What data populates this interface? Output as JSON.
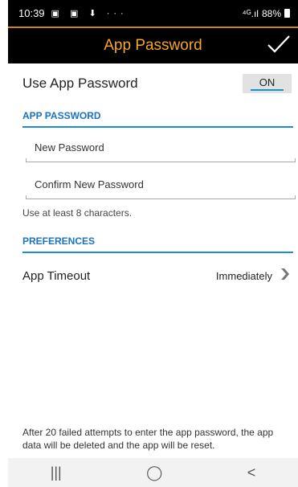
{
  "status_bar": {
    "time": "10:39",
    "icons": "▣ ▣ ⬇ ···",
    "signal": "⁴ᴳ.ıl",
    "battery": "88%"
  },
  "app_bar": {
    "title": "App Password",
    "confirm_icon": "check-icon",
    "title_color": "#f5a623"
  },
  "use_app_password": {
    "label": "Use App Password",
    "toggle_state": "ON"
  },
  "app_password_section": {
    "header": "APP PASSWORD",
    "new_password_placeholder": "New Password",
    "confirm_password_placeholder": "Confirm New Password",
    "hint": "Use at least 8 characters."
  },
  "preferences_section": {
    "header": "PREFERENCES",
    "app_timeout_label": "App Timeout",
    "app_timeout_value": "Immediately"
  },
  "footer": {
    "note": "After 20 failed attempts to enter the app password, the app data will be deleted and the app will be reset."
  },
  "nav_bar": {
    "recents": "|||",
    "home": "◯",
    "back": "<"
  },
  "colors": {
    "accent_blue": "#1a8fd6",
    "bar_black": "#000000",
    "title_orange": "#f5a623"
  }
}
